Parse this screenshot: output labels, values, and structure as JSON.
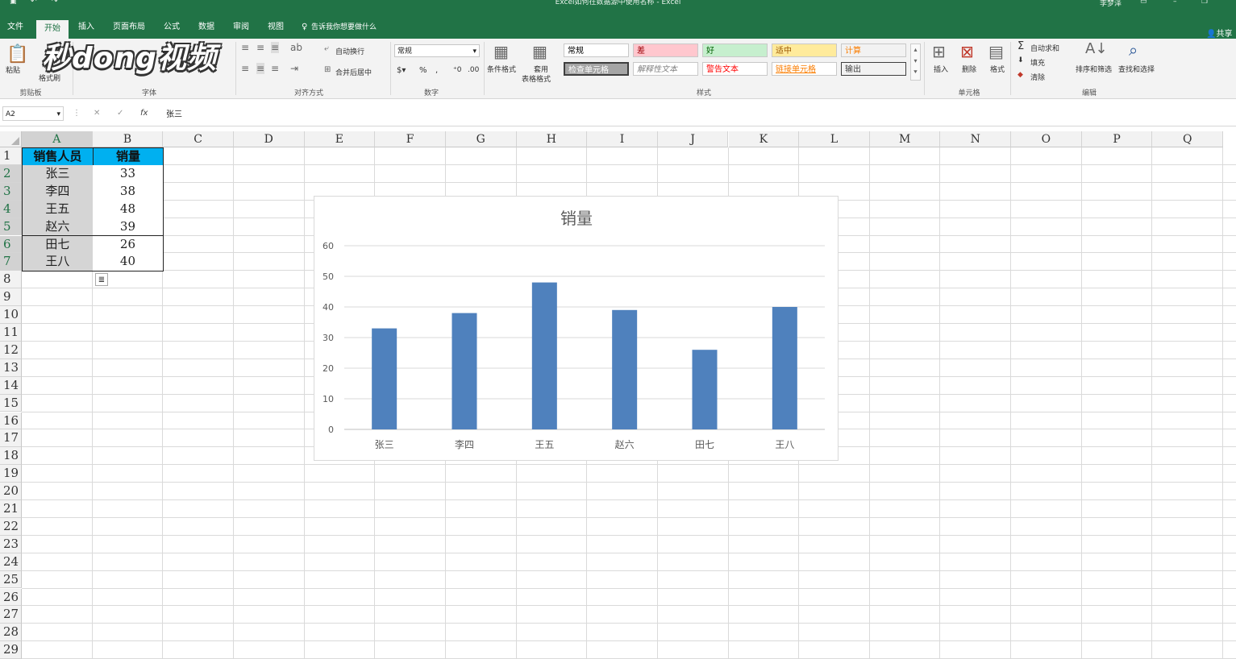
{
  "window": {
    "title": "Excel如何在数据源中使用名称 - Excel",
    "user": "李梦泽",
    "share": "共享"
  },
  "tabs": [
    {
      "label": "文件",
      "active": false
    },
    {
      "label": "开始",
      "active": true
    },
    {
      "label": "插入",
      "active": false
    },
    {
      "label": "页面布局",
      "active": false
    },
    {
      "label": "公式",
      "active": false
    },
    {
      "label": "数据",
      "active": false
    },
    {
      "label": "审阅",
      "active": false
    },
    {
      "label": "视图",
      "active": false
    }
  ],
  "tell_me": "告诉我你想要做什么",
  "ribbon": {
    "clipboard": {
      "paste": "粘贴",
      "painter": "格式刷",
      "group": "剪贴板"
    },
    "font": {
      "group": "字体"
    },
    "alignment": {
      "wrap": "自动换行",
      "merge": "合并后居中",
      "group": "对齐方式"
    },
    "number": {
      "format": "常规",
      "group": "数字"
    },
    "styles": {
      "conditional": "条件格式",
      "table_a": "套用",
      "table_b": "表格格式",
      "group": "样式",
      "cells": [
        {
          "label": "常规",
          "bg": "#ffffff",
          "fg": "#000000"
        },
        {
          "label": "差",
          "bg": "#ffc7ce",
          "fg": "#9c0006"
        },
        {
          "label": "好",
          "bg": "#c6efce",
          "fg": "#006100"
        },
        {
          "label": "适中",
          "bg": "#ffeb9c",
          "fg": "#9c5700"
        },
        {
          "label": "计算",
          "bg": "#f2f2f2",
          "fg": "#fa7d00"
        },
        {
          "label": "检查单元格",
          "bg": "#a5a5a5",
          "fg": "#ffffff"
        },
        {
          "label": "解释性文本",
          "bg": "#ffffff",
          "fg": "#7f7f7f"
        },
        {
          "label": "警告文本",
          "bg": "#ffffff",
          "fg": "#ff0000"
        },
        {
          "label": "链接单元格",
          "bg": "#ffffff",
          "fg": "#fa7d00"
        },
        {
          "label": "输出",
          "bg": "#f2f2f2",
          "fg": "#3f3f3f"
        }
      ]
    },
    "cells": {
      "insert": "插入",
      "delete": "删除",
      "format": "格式",
      "group": "单元格"
    },
    "editing": {
      "autosum": "自动求和",
      "fill": "填充",
      "clear": "清除",
      "sort": "排序和筛选",
      "find": "查找和选择",
      "group": "编辑"
    }
  },
  "watermark": "秒dong视频",
  "formula_bar": {
    "name_box": "A2",
    "fx": "fx",
    "value": "张三"
  },
  "columns": [
    "A",
    "B",
    "C",
    "D",
    "E",
    "F",
    "G",
    "H",
    "I",
    "J",
    "K",
    "L",
    "M",
    "N",
    "O",
    "P",
    "Q"
  ],
  "rows": [
    "1",
    "2",
    "3",
    "4",
    "5",
    "6",
    "7",
    "8",
    "9",
    "10",
    "11",
    "12",
    "13",
    "14",
    "15",
    "16",
    "17",
    "18",
    "19",
    "20",
    "21",
    "22",
    "23",
    "24",
    "25",
    "26",
    "27",
    "28",
    "29"
  ],
  "table": {
    "headers": [
      "销售人员",
      "销量"
    ],
    "rows": [
      [
        "张三",
        "33"
      ],
      [
        "李四",
        "38"
      ],
      [
        "王五",
        "48"
      ],
      [
        "赵六",
        "39"
      ],
      [
        "田七",
        "26"
      ],
      [
        "王八",
        "40"
      ]
    ]
  },
  "chart_data": {
    "type": "bar",
    "title": "销量",
    "categories": [
      "张三",
      "李四",
      "王五",
      "赵六",
      "田七",
      "王八"
    ],
    "values": [
      33,
      38,
      48,
      39,
      26,
      40
    ],
    "ylim": [
      0,
      60
    ],
    "yticks": [
      "0",
      "10",
      "20",
      "30",
      "40",
      "50",
      "60"
    ],
    "grid": true,
    "bar_color": "#4f81bd"
  }
}
